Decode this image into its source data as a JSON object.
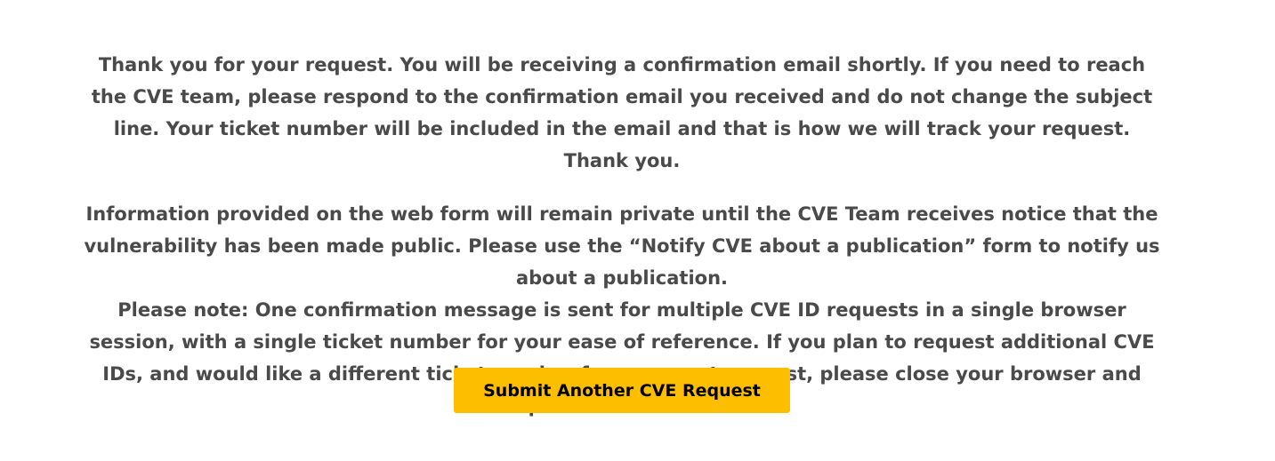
{
  "confirmation": {
    "paragraph_1": "Thank you for your request. You will be receiving a confirmation email shortly. If you need to reach the CVE team, please respond to the confirmation email you received and do not change the subject line. Your ticket number will be included in the email and that is how we will track your request. Thank you.",
    "paragraph_2": "Information provided on the web form will remain private until the CVE Team receives notice that the vulnerability has been made public. Please use the “Notify CVE about a publication” form to notify us about a publication.",
    "paragraph_3": "Please note: One confirmation message is sent for multiple CVE ID requests in a single browser session, with a single ticket number for your ease of reference. If you plan to request additional CVE IDs, and would like a different ticket number for your next request, please close your browser and open a new session."
  },
  "actions": {
    "submit_another_label": "Submit Another CVE Request"
  },
  "colors": {
    "text": "#4a4a4a",
    "button_background": "#fdbe00",
    "button_text": "#000000",
    "page_background": "#ffffff"
  }
}
